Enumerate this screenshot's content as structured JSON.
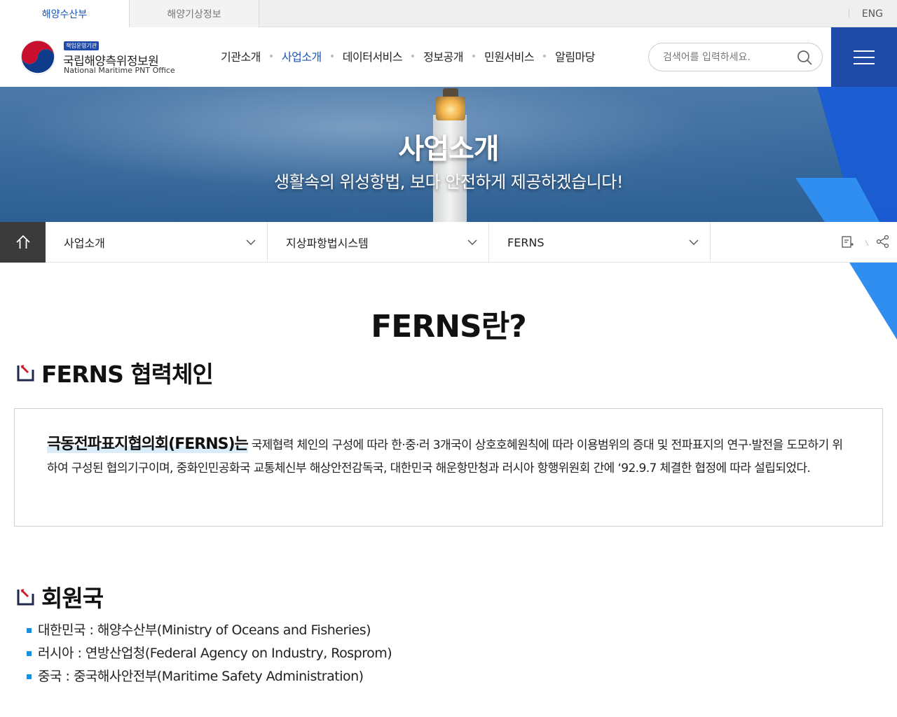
{
  "topbar": {
    "tabs": [
      "해양수산부",
      "해양기상정보"
    ],
    "lang": "ENG"
  },
  "header": {
    "logo_badge": "책임운영기관",
    "logo_ko": "국립해양측위정보원",
    "logo_en": "National Maritime PNT Office",
    "gnb": [
      "기관소개",
      "사업소개",
      "데이터서비스",
      "정보공개",
      "민원서비스",
      "알림마당"
    ],
    "gnb_active": "사업소개",
    "search_placeholder": "검색어를 입력하세요."
  },
  "banner": {
    "title": "사업소개",
    "subtitle": "생활속의 위성항법, 보다 안전하게 제공하겠습니다!"
  },
  "location": {
    "items": [
      "사업소개",
      "지상파항법시스템",
      "FERNS"
    ]
  },
  "content": {
    "page_title": "FERNS란?",
    "section1_title": "FERNS 협력체인",
    "intro_highlight": "극동전파표지협의회(FERNS)는",
    "intro_text": " 국제협력 체인의 구성에 따라 한·중·러 3개국이 상호호혜원칙에 따라 이용범위의 증대 및 전파표지의 연구·발전을 도모하기 위하여 구성된 협의기구이며, 중화인민공화국 교통체신부 해상안전감독국, 대한민국 해운항만청과 러시아 항행위원회 간에 ‘92.9.7 체결한 협정에 따라 설립되었다.",
    "section2_title": "회원국",
    "members": [
      "대한민국 : 해양수산부(Ministry of Oceans and Fisheries)",
      "러시아 : 연방산업청(Federal Agency on Industry, Rosprom)",
      "중국 : 중국해사안전부(Maritime Safety Administration)"
    ]
  },
  "colors": {
    "brand_blue": "#1f4aa8",
    "accent_blue": "#2f8ef0",
    "active_link": "#1a55b8"
  }
}
